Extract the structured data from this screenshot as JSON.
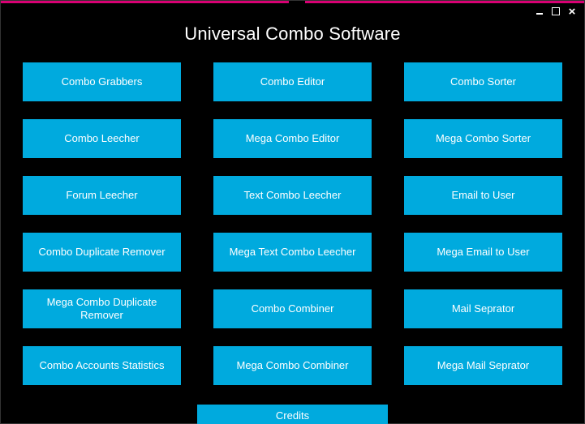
{
  "window": {
    "title": "Universal Combo Software"
  },
  "buttons": {
    "r0c0": "Combo Grabbers",
    "r0c1": "Combo Editor",
    "r0c2": "Combo Sorter",
    "r1c0": "Combo Leecher",
    "r1c1": "Mega Combo Editor",
    "r1c2": "Mega Combo Sorter",
    "r2c0": "Forum Leecher",
    "r2c1": "Text Combo Leecher",
    "r2c2": "Email to User",
    "r3c0": "Combo Duplicate Remover",
    "r3c1": "Mega Text Combo Leecher",
    "r3c2": "Mega Email to User",
    "r4c0": "Mega Combo Duplicate Remover",
    "r4c1": "Combo Combiner",
    "r4c2": "Mail Seprator",
    "r5c0": "Combo Accounts Statistics",
    "r5c1": "Mega Combo Combiner",
    "r5c2": "Mega Mail Seprator"
  },
  "footer": {
    "credits": "Credits"
  },
  "colors": {
    "accent": "#d80073",
    "tile": "#00aade",
    "background": "#000000"
  }
}
